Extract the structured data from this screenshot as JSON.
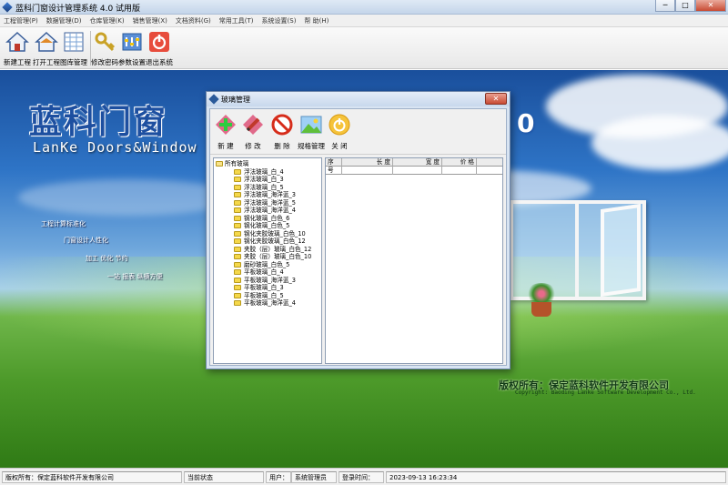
{
  "window": {
    "title": "蓝科门窗设计管理系统 4.0 试用版",
    "min": "─",
    "max": "□",
    "close": "✕"
  },
  "menu": [
    "工程管理(P)",
    "数据管理(D)",
    "仓库管理(K)",
    "销售管理(X)",
    "文档资料(G)",
    "常用工具(T)",
    "系统设置(S)",
    "帮 助(H)"
  ],
  "toolbar": {
    "new_project": "新建工程",
    "open_project": "打开工程",
    "library": "图库管理",
    "change_password": "修改密码",
    "parameters": "参数设置",
    "exit": "退出系统"
  },
  "desktop": {
    "brand_cn": "蓝科门窗",
    "brand_version": "0",
    "brand_en": "LanKe Doors&Window",
    "taglines": [
      "工程计算标准化",
      "门窗设计人性化",
      "加工 优化 节约",
      "一站 报表 纵横方便"
    ],
    "copyright_cn": "版权所有：保定蓝科软件开发有限公司",
    "copyright_en": "Copyright: Baoding Lanke Software Development Co., Ltd."
  },
  "dialog": {
    "title": "玻璃管理",
    "close": "✕",
    "buttons": {
      "new": "新 建",
      "edit": "修 改",
      "delete": "删 除",
      "spec": "规格管理",
      "close": "关 闭"
    },
    "tree_root": "所有玻璃",
    "tree_items": [
      "浮法玻璃_白_4",
      "浮法玻璃_白_3",
      "浮法玻璃_白_5",
      "浮法玻璃_海洋蓝_3",
      "浮法玻璃_海洋蓝_5",
      "浮法玻璃_海洋蓝_4",
      "钢化玻璃_白色_6",
      "钢化玻璃_白色_5",
      "钢化夹胶玻璃_白色_10",
      "钢化夹胶玻璃_白色_12",
      "夹胶（层）玻璃_白色_12",
      "夹胶（层）玻璃_白色_10",
      "磨砂玻璃_白色_5",
      "平板玻璃_白_4",
      "平板玻璃_海洋蓝_3",
      "平板玻璃_白_3",
      "平板玻璃_白_5",
      "平板玻璃_海洋蓝_4"
    ],
    "grid_headers": [
      "序号",
      "长 度",
      "宽 度",
      "价 格"
    ]
  },
  "status": {
    "copyright_label": "版权所有：",
    "copyright_value": "保定蓝科软件开发有限公司",
    "state_label": "当前状态",
    "state_value": "",
    "user_label": "用户：",
    "user_value": "系统管理员",
    "login_label": "登录时间：",
    "login_value": "2023-09-13 16:23:34"
  },
  "colors": {
    "accent": "#2a5a9a",
    "brand_blue": "#1d4fa0",
    "folder": "#f5d84a"
  }
}
